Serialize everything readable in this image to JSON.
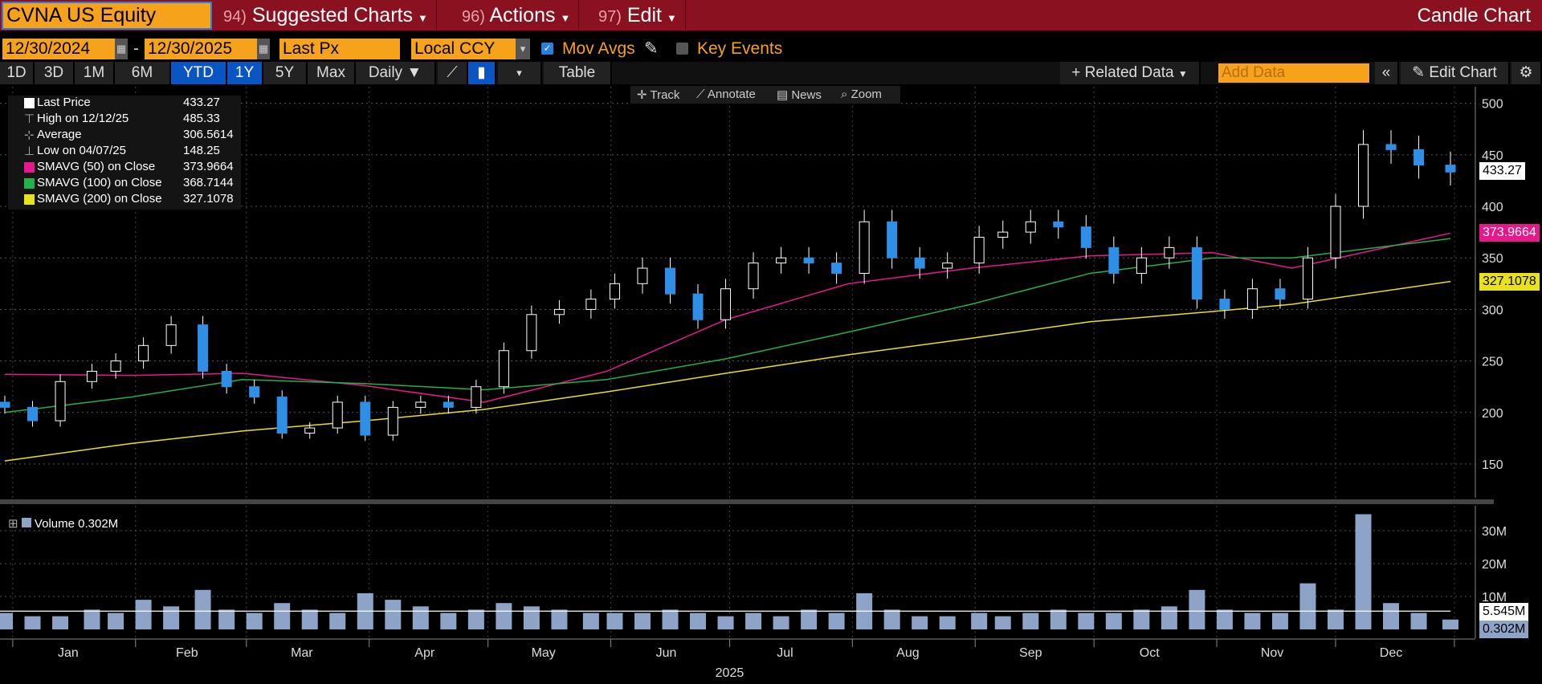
{
  "header": {
    "ticker": "CVNA US Equity",
    "suggested": {
      "num": "94)",
      "label": "Suggested Charts"
    },
    "actions": {
      "num": "96)",
      "label": "Actions"
    },
    "edit": {
      "num": "97)",
      "label": "Edit"
    },
    "title": "Candle Chart"
  },
  "controls": {
    "start_date": "12/30/2024",
    "dash": "-",
    "end_date": "12/30/2025",
    "field": "Last Px",
    "currency": "Local CCY",
    "mov_avgs": "Mov Avgs",
    "mov_avgs_checked": true,
    "key_events": "Key Events",
    "key_events_checked": false
  },
  "ranges": [
    "1D",
    "3D",
    "1M",
    "6M",
    "YTD",
    "1Y",
    "5Y",
    "Max"
  ],
  "active_ranges": [
    "YTD",
    "1Y"
  ],
  "frequency": "Daily ▼",
  "table_label": "Table",
  "related_data": "+ Related Data",
  "add_data_placeholder": "Add Data",
  "edit_chart": "Edit Chart",
  "tools": [
    "Track",
    "Annotate",
    "News",
    "Zoom"
  ],
  "legend": [
    {
      "label": "Last Price",
      "value": "433.27",
      "color": "#ffffff",
      "icon": "square"
    },
    {
      "label": "High on 12/12/25",
      "value": "485.33",
      "icon": "high-marker"
    },
    {
      "label": "Average",
      "value": "306.5614",
      "icon": "average-marker"
    },
    {
      "label": "Low on 04/07/25",
      "value": "148.25",
      "icon": "low-marker"
    },
    {
      "label": "SMAVG (50)  on Close",
      "value": "373.9664",
      "color": "#e6198c",
      "icon": "square"
    },
    {
      "label": "SMAVG (100)  on Close",
      "value": "368.7144",
      "color": "#22b14c",
      "icon": "square"
    },
    {
      "label": "SMAVG (200)  on Close",
      "value": "327.1078",
      "color": "#e8e21a",
      "icon": "square"
    }
  ],
  "price_tags": {
    "last": "433.27",
    "sma50": "373.9664",
    "sma200": "327.1078"
  },
  "volume_legend": "Volume 0.302M",
  "volume_tags": {
    "avg": "5.545M",
    "last": "0.302M"
  },
  "chart_data": {
    "type": "candlestick",
    "frequency": "Daily",
    "year_label": "2025",
    "x_tick_labels": [
      "Jan",
      "Feb",
      "Mar",
      "Apr",
      "May",
      "Jun",
      "Jul",
      "Aug",
      "Sep",
      "Oct",
      "Nov",
      "Dec"
    ],
    "y_tick_labels": [
      "150",
      "200",
      "250",
      "300",
      "350",
      "400",
      "450",
      "500"
    ],
    "ylim": [
      110,
      515
    ],
    "dates": [
      "2024-12-30",
      "2025-01-06",
      "2025-01-13",
      "2025-01-21",
      "2025-01-27",
      "2025-02-03",
      "2025-02-10",
      "2025-02-18",
      "2025-02-24",
      "2025-03-03",
      "2025-03-10",
      "2025-03-17",
      "2025-03-24",
      "2025-03-31",
      "2025-04-07",
      "2025-04-14",
      "2025-04-21",
      "2025-04-28",
      "2025-05-05",
      "2025-05-12",
      "2025-05-19",
      "2025-05-27",
      "2025-06-02",
      "2025-06-09",
      "2025-06-16",
      "2025-06-23",
      "2025-06-30",
      "2025-07-07",
      "2025-07-14",
      "2025-07-21",
      "2025-07-28",
      "2025-08-04",
      "2025-08-11",
      "2025-08-18",
      "2025-08-25",
      "2025-09-02",
      "2025-09-08",
      "2025-09-15",
      "2025-09-22",
      "2025-09-29",
      "2025-10-06",
      "2025-10-13",
      "2025-10-20",
      "2025-10-27",
      "2025-11-03",
      "2025-11-10",
      "2025-11-17",
      "2025-11-24",
      "2025-12-01",
      "2025-12-08",
      "2025-12-15",
      "2025-12-22",
      "2025-12-30"
    ],
    "close": [
      205,
      192,
      230,
      240,
      250,
      265,
      285,
      240,
      225,
      215,
      180,
      185,
      210,
      178,
      205,
      210,
      205,
      225,
      260,
      295,
      300,
      310,
      325,
      340,
      315,
      290,
      320,
      345,
      350,
      345,
      335,
      385,
      350,
      340,
      345,
      370,
      375,
      385,
      380,
      360,
      335,
      350,
      360,
      310,
      300,
      320,
      310,
      350,
      400,
      460,
      455,
      440,
      433.27
    ],
    "sma": [
      {
        "name": "SMAVG (50)",
        "color": "#e6198c",
        "dates": [
          "2024-12-30",
          "2025-01-31",
          "2025-02-28",
          "2025-03-31",
          "2025-04-30",
          "2025-05-31",
          "2025-06-30",
          "2025-07-31",
          "2025-08-31",
          "2025-09-30",
          "2025-10-31",
          "2025-11-20",
          "2025-12-30"
        ],
        "values": [
          237,
          236,
          238,
          226,
          210,
          240,
          290,
          325,
          340,
          352,
          355,
          340,
          373.97
        ]
      },
      {
        "name": "SMAVG (100)",
        "color": "#22b14c",
        "dates": [
          "2024-12-30",
          "2025-01-31",
          "2025-02-28",
          "2025-03-31",
          "2025-04-30",
          "2025-05-31",
          "2025-06-30",
          "2025-07-31",
          "2025-08-31",
          "2025-09-30",
          "2025-10-31",
          "2025-11-20",
          "2025-12-30"
        ],
        "values": [
          200,
          215,
          232,
          228,
          222,
          232,
          252,
          278,
          305,
          335,
          350,
          350,
          368.71
        ]
      },
      {
        "name": "SMAVG (200)",
        "color": "#e8e21a",
        "dates": [
          "2024-12-30",
          "2025-01-31",
          "2025-02-28",
          "2025-03-31",
          "2025-04-30",
          "2025-05-31",
          "2025-06-30",
          "2025-07-31",
          "2025-08-31",
          "2025-09-30",
          "2025-10-31",
          "2025-11-20",
          "2025-12-30"
        ],
        "values": [
          153,
          170,
          182,
          192,
          203,
          220,
          238,
          256,
          272,
          288,
          298,
          305,
          327.11
        ]
      }
    ],
    "volume": {
      "unit": "M",
      "y_tick_labels": [
        "10M",
        "20M",
        "30M"
      ],
      "ylim": [
        0,
        38
      ],
      "values": [
        5,
        4,
        4,
        6,
        5,
        9,
        7,
        12,
        6,
        5,
        8,
        6,
        5,
        11,
        9,
        7,
        5,
        6,
        8,
        7,
        6,
        5,
        5,
        5,
        6,
        5,
        4,
        5,
        4,
        6,
        5,
        11,
        6,
        4,
        4,
        5,
        4,
        5,
        6,
        5,
        5,
        6,
        7,
        12,
        6,
        5,
        5,
        14,
        6,
        35,
        8,
        5,
        3
      ],
      "average": 5.545
    }
  }
}
